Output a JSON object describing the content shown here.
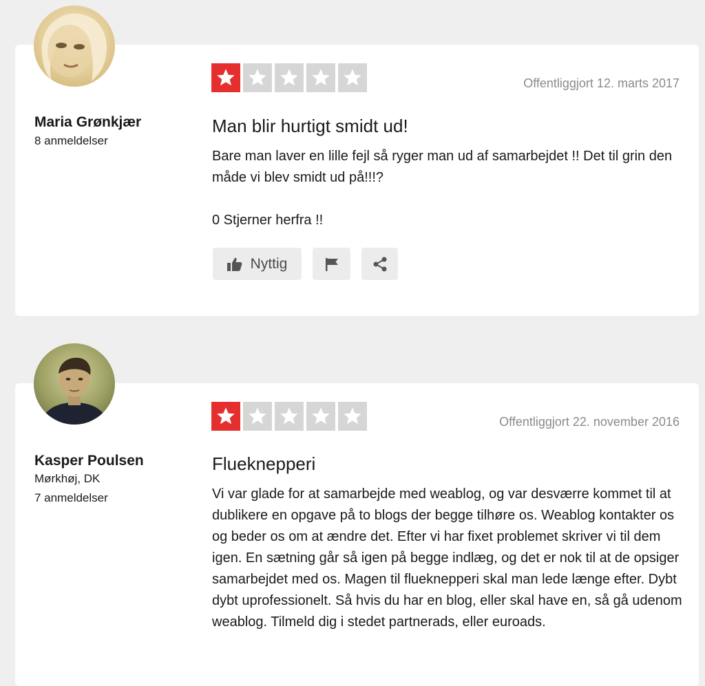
{
  "colors": {
    "star_active": "#e52f2f",
    "star_inactive": "#d6d6d6",
    "background": "#efefef"
  },
  "reviews": [
    {
      "reviewer": {
        "name": "Maria Grønkjær",
        "review_count": "8 anmeldelser"
      },
      "rating": 1,
      "max_rating": 5,
      "published": "Offentliggjort 12. marts 2017",
      "title": "Man blir hurtigt smidt ud!",
      "body": [
        "Bare man laver en lille fejl så ryger man ud af samarbejdet !! Det til grin den måde vi blev smidt ud på!!!?",
        "0 Stjerner herfra !!"
      ],
      "actions": {
        "useful_label": "Nyttig",
        "useful_icon": "thumbs-up-icon",
        "flag_icon": "flag-icon",
        "share_icon": "share-icon"
      }
    },
    {
      "reviewer": {
        "name": "Kasper Poulsen",
        "location": "Mørkhøj, DK",
        "review_count": "7 anmeldelser"
      },
      "rating": 1,
      "max_rating": 5,
      "published": "Offentliggjort 22. november 2016",
      "title": "Flueknepperi",
      "body": [
        "Vi var glade for at samarbejde med weablog, og var desværre kommet til at dublikere en opgave på to blogs der begge tilhøre os. Weablog kontakter os og beder os om at ændre det. Efter vi har fixet problemet skriver vi til dem igen. En sætning går så igen på begge indlæg, og det er nok til at de opsiger samarbejdet med os. Magen til flueknepperi skal man lede længe efter. Dybt dybt uprofessionelt. Så hvis du har en blog, eller skal have en, så gå udenom weablog. Tilmeld dig i stedet partnerads, eller euroads."
      ]
    }
  ]
}
